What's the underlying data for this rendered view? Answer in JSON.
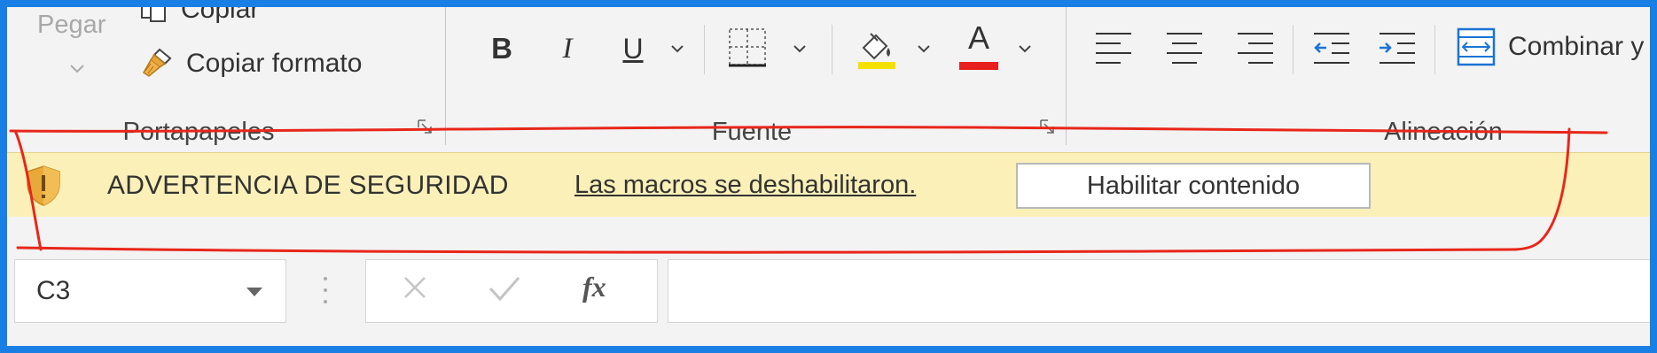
{
  "ribbon": {
    "clipboard": {
      "paste_label": "Pegar",
      "copy_label": "Copiar",
      "format_painter_label": "Copiar formato",
      "group_label": "Portapapeles"
    },
    "font": {
      "bold_label": "B",
      "italic_label": "I",
      "underline_label": "U",
      "font_color_letter": "A",
      "highlight_color": "#f5e100",
      "font_color": "#e81e1e",
      "group_label": "Fuente"
    },
    "alignment": {
      "merge_label": "Combinar y",
      "group_label": "Alineación"
    }
  },
  "security_bar": {
    "title": "ADVERTENCIA DE SEGURIDAD",
    "message": "Las macros se deshabilitaron.",
    "enable_button": "Habilitar contenido"
  },
  "formula_bar": {
    "name_box": "C3",
    "function_label": "fx",
    "formula": ""
  },
  "annotation": {
    "color": "#e8261a"
  }
}
